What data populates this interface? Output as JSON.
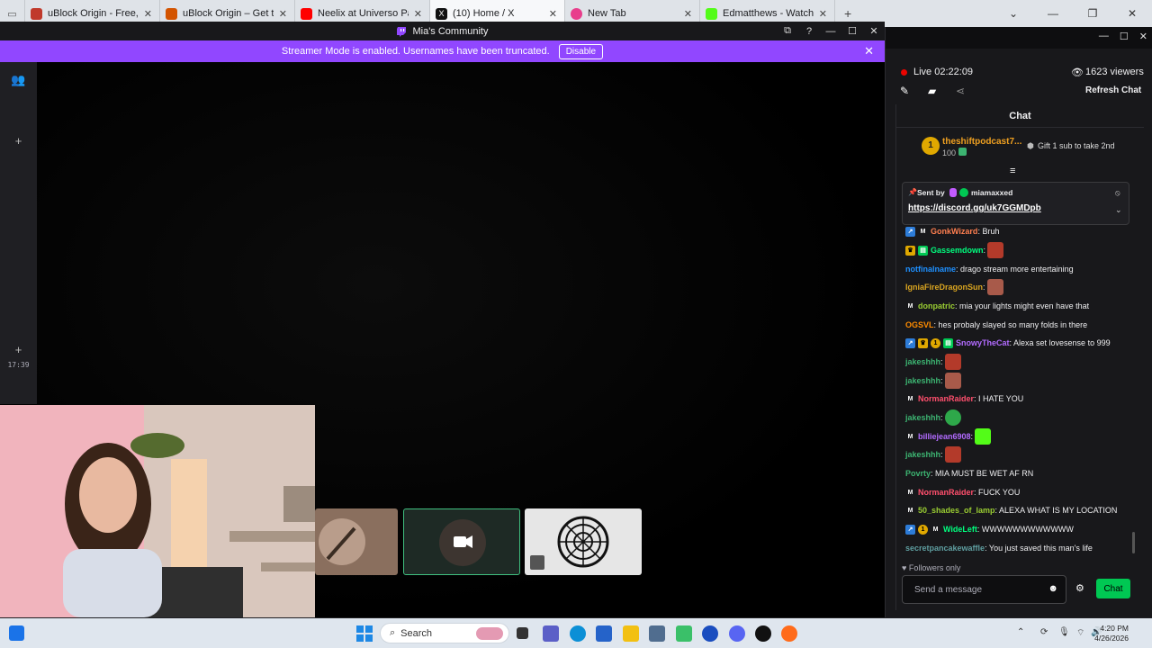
{
  "browser": {
    "tabs": [
      {
        "title": "uBlock Origin - Free, open-sou",
        "color": "#c0392b"
      },
      {
        "title": "uBlock Origin – Get this Extensi",
        "color": "#d35400"
      },
      {
        "title": "Neelix at Universo Paralello - Yo",
        "color": "#ff0000"
      },
      {
        "title": "(10) Home / X",
        "color": "#111111"
      },
      {
        "title": "New Tab",
        "color": "#e83e8c"
      },
      {
        "title": "Edmatthews - Watch clips on Ki",
        "color": "#53fc18"
      }
    ],
    "new_tab_icon": "plus-icon"
  },
  "player": {
    "window_title": "Mia's Community",
    "banner_text": "Streamer Mode is enabled. Usernames have been truncated.",
    "banner_button": "Disable",
    "timestamp": "17:39"
  },
  "chat": {
    "live_text": "Live 02:22:09",
    "viewers": "1623 viewers",
    "refresh_label": "Refresh Chat",
    "header": "Chat",
    "hype": {
      "user": "theshiftpodcast7...",
      "amount": "100",
      "rank": "1",
      "gift_text": "Gift 1 sub to take 2nd"
    },
    "pinned": {
      "sent_by": "Sent by",
      "user": "miamaxxed",
      "link": "https://discord.gg/uk7GGMDpb"
    },
    "messages": [
      {
        "user": "GonkWizard",
        "color": "#ff7f50",
        "text": ": Bruh"
      },
      {
        "user": "Gassemdown",
        "color": "#00ff7f",
        "text": ":"
      },
      {
        "user": "notfinalname",
        "color": "#1e90ff",
        "text": ": drago stream more entertaining"
      },
      {
        "user": "IgniaFireDragonSun",
        "color": "#daa520",
        "text": ":"
      },
      {
        "user": "donpatric",
        "color": "#9acd32",
        "text": ": mia your lights might even have that"
      },
      {
        "user": "OGSVL",
        "color": "#ff8c00",
        "text": ": hes probaly slayed so many folds in there"
      },
      {
        "user": "SnowyTheCat",
        "color": "#8a2be2",
        "text": ": Alexa set lovesense to 999"
      },
      {
        "user": "jakeshhh",
        "color": "#2e8b57",
        "text": ":"
      },
      {
        "user": "jakeshhh",
        "color": "#2e8b57",
        "text": ":"
      },
      {
        "user": "NormanRaider",
        "color": "#ff4f6d",
        "text": ": I HATE YOU"
      },
      {
        "user": "jakeshhh",
        "color": "#2e8b57",
        "text": ":"
      },
      {
        "user": "billiejean6908",
        "color": "#b26bff",
        "text": ":"
      },
      {
        "user": "jakeshhh",
        "color": "#2e8b57",
        "text": ":"
      },
      {
        "user": "Povrty",
        "color": "#3cb371",
        "text": ": MIA MUST BE WET AF RN"
      },
      {
        "user": "NormanRaider",
        "color": "#ff4f6d",
        "text": ": FUCK YOU"
      },
      {
        "user": "50_shades_of_lamp",
        "color": "#9acd32",
        "text": ": ALEXA WHAT IS MY LOCATION"
      },
      {
        "user": "WideLeft",
        "color": "#00ff7f",
        "text": ": WWWWWWWWWWWW"
      },
      {
        "user": "secretpancakewaffle",
        "color": "#5f9ea0",
        "text": ": You just saved this man's life"
      }
    ],
    "followers_only": "Followers only",
    "input_placeholder": "Send a message",
    "send_button": "Chat"
  },
  "taskbar": {
    "search_label": "Search",
    "time": "4:20 PM",
    "date": "4/26/2026"
  }
}
